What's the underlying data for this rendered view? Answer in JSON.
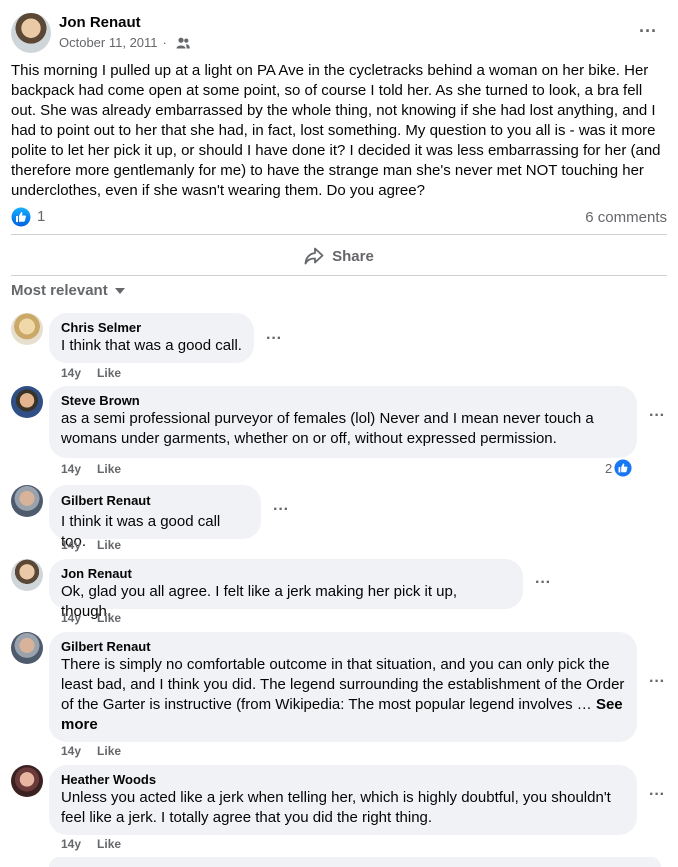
{
  "post": {
    "author": "Jon Renaut",
    "date": "October 11, 2011",
    "separator": "·",
    "audience_icon": "friends-icon",
    "text": "This morning I pulled up at a light on PA Ave in the cycletracks behind a woman on her bike. Her backpack had come open at some point, so of course I told her. As she turned to look, a bra fell out. She was already embarrassed by the whole thing, not knowing if she had lost anything, and I had to point out to her that she had, in fact, lost something. My question to you all is - was it more polite to let her pick it up, or should I have done it? I decided it was less embarrassing for her (and therefore more gentlemanly for me) to have the strange man she's never met NOT touching her underclothes, even if she wasn't wearing them. Do you agree?",
    "like_count": "1",
    "comments_count": "6 comments",
    "more_icon": "···"
  },
  "actions": {
    "share_label": "Share"
  },
  "sort": {
    "label": "Most relevant"
  },
  "comments": [
    {
      "name": "Chris Selmer",
      "text": "I think that was a good call.",
      "age": "14y",
      "like": "Like"
    },
    {
      "name": "Steve Brown",
      "text": "as a semi professional purveyor of females (lol) Never and I mean never touch a womans under garments, whether on or off, without expressed permission.",
      "age": "14y",
      "like": "Like",
      "reactions": "2"
    },
    {
      "name": "Gilbert Renaut",
      "text": "I think it was a good call too.",
      "age": "14y",
      "like": "Like"
    },
    {
      "name": "Jon Renaut",
      "text": "Ok, glad you all agree. I felt like a jerk making her pick it up, though.",
      "age": "14y",
      "like": "Like"
    },
    {
      "name": "Gilbert Renaut",
      "text": "There is simply no comfortable outcome in that situation, and you can only pick the least bad, and I think you did. The legend surrounding the establishment of the Order of the Garter is instructive (from Wikipedia: The most popular legend involves … ",
      "see_more": "See more",
      "age": "14y",
      "like": "Like"
    },
    {
      "name": "Heather Woods",
      "text": "Unless you acted like a jerk when telling her, which is highly doubtful, you shouldn't feel like a jerk. I totally agree that you did the right thing.",
      "age": "14y",
      "like": "Like"
    }
  ],
  "colors": {
    "secondary_text": "#65676b",
    "bubble": "#f0f2f5",
    "like_blue": "#1877f2"
  }
}
